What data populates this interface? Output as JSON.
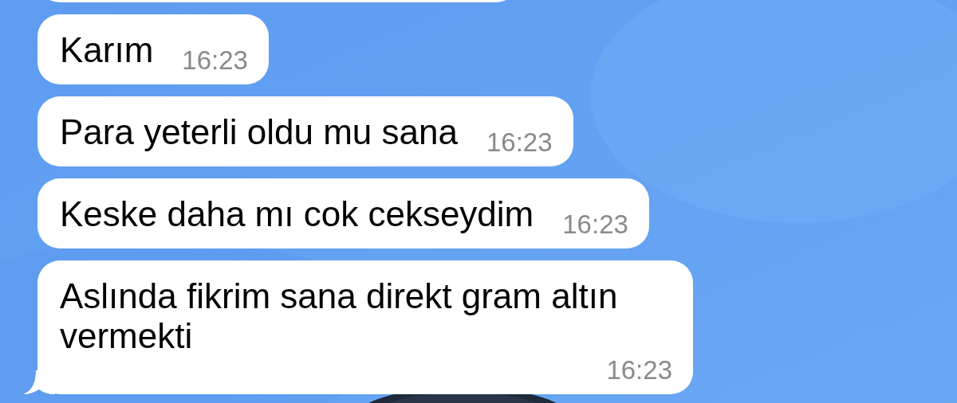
{
  "chat": {
    "partial_bubble_above": true,
    "messages": [
      {
        "text": "Karım",
        "time": "16:23",
        "tail": false
      },
      {
        "text": "Para yeterli oldu mu sana",
        "time": "16:23",
        "tail": false
      },
      {
        "text": "Keske daha mı cok cekseydim",
        "time": "16:23",
        "tail": false
      },
      {
        "text": "Aslında fikrim sana direkt gram altın vermekti",
        "time": "16:23",
        "tail": true
      }
    ]
  }
}
